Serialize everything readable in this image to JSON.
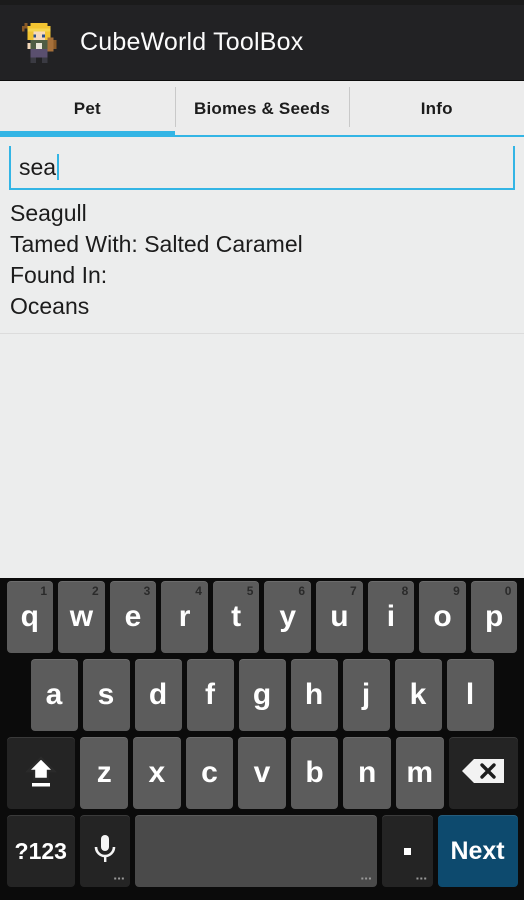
{
  "app": {
    "title": "CubeWorld ToolBox",
    "icon_name": "cubeworld-character-icon",
    "accent_color": "#33b5e5",
    "titlebar_color": "#222224",
    "action_key_color": "#0d4a6e"
  },
  "tabs": [
    {
      "label": "Pet",
      "active": true
    },
    {
      "label": "Biomes & Seeds",
      "active": false
    },
    {
      "label": "Info",
      "active": false
    }
  ],
  "search": {
    "value": "sea",
    "placeholder": "",
    "focused": true
  },
  "results": {
    "lines": [
      "Seagull",
      "Tamed With: Salted Caramel",
      "Found In:",
      "Oceans"
    ]
  },
  "keyboard": {
    "row1": [
      {
        "key": "q",
        "hint": "1"
      },
      {
        "key": "w",
        "hint": "2"
      },
      {
        "key": "e",
        "hint": "3"
      },
      {
        "key": "r",
        "hint": "4"
      },
      {
        "key": "t",
        "hint": "5"
      },
      {
        "key": "y",
        "hint": "6"
      },
      {
        "key": "u",
        "hint": "7"
      },
      {
        "key": "i",
        "hint": "8"
      },
      {
        "key": "o",
        "hint": "9"
      },
      {
        "key": "p",
        "hint": "0"
      }
    ],
    "row2": [
      {
        "key": "a"
      },
      {
        "key": "s"
      },
      {
        "key": "d"
      },
      {
        "key": "f"
      },
      {
        "key": "g"
      },
      {
        "key": "h"
      },
      {
        "key": "j"
      },
      {
        "key": "k"
      },
      {
        "key": "l"
      }
    ],
    "row3": [
      {
        "key": "z"
      },
      {
        "key": "x"
      },
      {
        "key": "c"
      },
      {
        "key": "v"
      },
      {
        "key": "b"
      },
      {
        "key": "n"
      },
      {
        "key": "m"
      }
    ],
    "shift_label": "shift-key",
    "backspace_label": "backspace-key",
    "symbols_label": "?123",
    "mic_label": "microphone-key",
    "space_label": "",
    "period_label": ".",
    "action_label": "Next"
  }
}
